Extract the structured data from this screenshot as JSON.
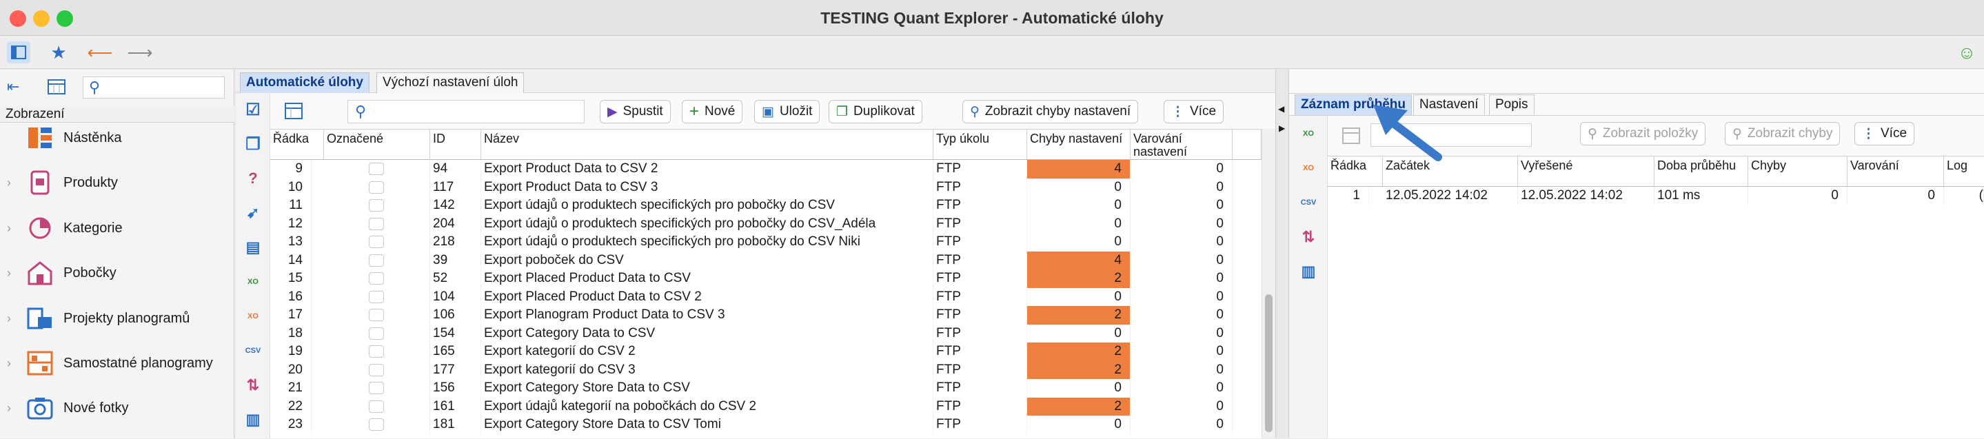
{
  "window": {
    "title": "TESTING Quant Explorer - Automatické úlohy",
    "colors": {
      "close": "#fd5f57",
      "min": "#febc2e",
      "max": "#28c840"
    }
  },
  "sidebar": {
    "header": "Zobrazení",
    "items": [
      {
        "label": "Nástěnka",
        "icon": "dashboard-icon"
      },
      {
        "label": "Produkty",
        "icon": "product-icon"
      },
      {
        "label": "Kategorie",
        "icon": "category-icon"
      },
      {
        "label": "Pobočky",
        "icon": "store-icon"
      },
      {
        "label": "Projekty planogramů",
        "icon": "planogram-project-icon"
      },
      {
        "label": "Samostatné planogramy",
        "icon": "planogram-icon"
      },
      {
        "label": "Nové fotky",
        "icon": "camera-icon"
      }
    ]
  },
  "middle": {
    "tabs": [
      "Automatické úlohy",
      "Výchozí nastavení úloh"
    ],
    "toolbar": {
      "run": "Spustit",
      "new": "Nové",
      "save": "Uložit",
      "duplicate": "Duplikovat",
      "show_errors": "Zobrazit chyby nastavení",
      "more": "Více"
    },
    "columns": [
      "Řádka",
      "Označené",
      "ID",
      "Název",
      "Typ úkolu",
      "Chyby nastavení",
      "Varování nastavení"
    ],
    "rows": [
      {
        "row": "9",
        "id": "94",
        "name": "Export Product Data to CSV 2",
        "type": "FTP",
        "errors": "4",
        "warnings": "0"
      },
      {
        "row": "10",
        "id": "117",
        "name": "Export Product Data to CSV 3",
        "type": "FTP",
        "errors": "0",
        "warnings": "0"
      },
      {
        "row": "11",
        "id": "142",
        "name": "Export údajů o produktech specifických pro pobočky do CSV",
        "type": "FTP",
        "errors": "0",
        "warnings": "0"
      },
      {
        "row": "12",
        "id": "204",
        "name": "Export údajů o produktech specifických pro pobočky do CSV_Adéla",
        "type": "FTP",
        "errors": "0",
        "warnings": "0"
      },
      {
        "row": "13",
        "id": "218",
        "name": "Export údajů o produktech specifických pro pobočky do CSV Niki",
        "type": "FTP",
        "errors": "0",
        "warnings": "0"
      },
      {
        "row": "14",
        "id": "39",
        "name": "Export poboček do CSV",
        "type": "FTP",
        "errors": "4",
        "warnings": "0"
      },
      {
        "row": "15",
        "id": "52",
        "name": "Export Placed Product Data to CSV",
        "type": "FTP",
        "errors": "2",
        "warnings": "0"
      },
      {
        "row": "16",
        "id": "104",
        "name": "Export Placed Product Data to CSV 2",
        "type": "FTP",
        "errors": "0",
        "warnings": "0"
      },
      {
        "row": "17",
        "id": "106",
        "name": "Export Planogram Product Data to CSV 3",
        "type": "FTP",
        "errors": "2",
        "warnings": "0"
      },
      {
        "row": "18",
        "id": "154",
        "name": "Export Category Data to CSV",
        "type": "FTP",
        "errors": "0",
        "warnings": "0"
      },
      {
        "row": "19",
        "id": "165",
        "name": "Export kategorií do CSV 2",
        "type": "FTP",
        "errors": "2",
        "warnings": "0"
      },
      {
        "row": "20",
        "id": "177",
        "name": "Export kategorií do CSV 3",
        "type": "FTP",
        "errors": "2",
        "warnings": "0"
      },
      {
        "row": "21",
        "id": "156",
        "name": "Export Category Store Data to CSV",
        "type": "FTP",
        "errors": "0",
        "warnings": "0"
      },
      {
        "row": "22",
        "id": "161",
        "name": "Export údajů kategorií na pobočkách do CSV 2",
        "type": "FTP",
        "errors": "2",
        "warnings": "0"
      },
      {
        "row": "23",
        "id": "181",
        "name": "Export Category Store Data to CSV Tomi",
        "type": "FTP",
        "errors": "0",
        "warnings": "0"
      }
    ]
  },
  "right": {
    "tabs": [
      "Záznam průběhu",
      "Nastavení",
      "Popis"
    ],
    "toolbar": {
      "show_items": "Zobrazit položky",
      "show_errors": "Zobrazit chyby",
      "more": "Více"
    },
    "columns": [
      "Řádka",
      "Začátek",
      "Vyřešené",
      "Doba průběhu",
      "Chyby",
      "Varování",
      "Log"
    ],
    "rows": [
      {
        "row": "1",
        "start": "12.05.2022 14:02",
        "resolved": "12.05.2022 14:02",
        "duration": "101 ms",
        "errors": "0",
        "warnings": "0",
        "log": "("
      }
    ]
  }
}
